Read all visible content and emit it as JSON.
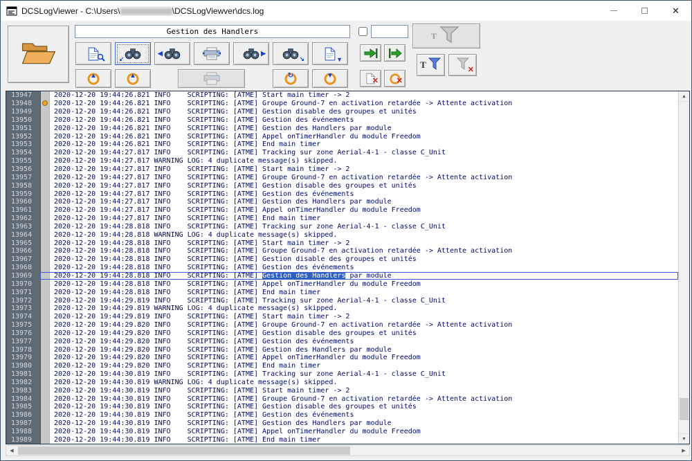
{
  "window": {
    "title_prefix": "DCSLogViewer - C:\\Users\\",
    "title_redacted": "██████████████",
    "title_suffix": "\\DCSLogViewver\\dcs.log"
  },
  "icons": {
    "close": "✕",
    "minimize": "–",
    "maximize": "▢",
    "arrow_up": "▲",
    "arrow_down": "▼",
    "arrow_left": "◀",
    "arrow_right": "▶",
    "arrow_down_left": "↙",
    "arrow_down_right": "↘",
    "refresh": "↻",
    "red_x": "✕",
    "letter_t": "T",
    "scroll_up": "▲",
    "scroll_down": "▼",
    "scroll_left": "◀",
    "scroll_right": "▶"
  },
  "search": {
    "value": "Gestion des Handlers"
  },
  "filter_input": {
    "value": ""
  },
  "log": {
    "selected_line": 13969,
    "marker_line": 13948,
    "highlight": "Gestion des Handlers",
    "entries": [
      {
        "n": 13947,
        "t": "2020-12-20 19:44:26.821 INFO    SCRIPTING: [ATME] Start main timer -> 2"
      },
      {
        "n": 13948,
        "t": "2020-12-20 19:44:26.821 INFO    SCRIPTING: [ATME] Groupe Ground-7 en activation retardée -> Attente activation"
      },
      {
        "n": 13949,
        "t": "2020-12-20 19:44:26.821 INFO    SCRIPTING: [ATME] Gestion disable des groupes et unités"
      },
      {
        "n": 13950,
        "t": "2020-12-20 19:44:26.821 INFO    SCRIPTING: [ATME] Gestion des événements"
      },
      {
        "n": 13951,
        "t": "2020-12-20 19:44:26.821 INFO    SCRIPTING: [ATME] Gestion des Handlers par module"
      },
      {
        "n": 13952,
        "t": "2020-12-20 19:44:26.821 INFO    SCRIPTING: [ATME] Appel onTimerHandler du module Freedom"
      },
      {
        "n": 13953,
        "t": "2020-12-20 19:44:26.821 INFO    SCRIPTING: [ATME] End main timer"
      },
      {
        "n": 13954,
        "t": "2020-12-20 19:44:27.817 INFO    SCRIPTING: [ATME] Tracking sur zone Aerial-4-1 - classe C_Unit"
      },
      {
        "n": 13955,
        "t": "2020-12-20 19:44:27.817 WARNING LOG: 4 duplicate message(s) skipped."
      },
      {
        "n": 13956,
        "t": "2020-12-20 19:44:27.817 INFO    SCRIPTING: [ATME] Start main timer -> 2"
      },
      {
        "n": 13957,
        "t": "2020-12-20 19:44:27.817 INFO    SCRIPTING: [ATME] Groupe Ground-7 en activation retardée -> Attente activation"
      },
      {
        "n": 13958,
        "t": "2020-12-20 19:44:27.817 INFO    SCRIPTING: [ATME] Gestion disable des groupes et unités"
      },
      {
        "n": 13959,
        "t": "2020-12-20 19:44:27.817 INFO    SCRIPTING: [ATME] Gestion des événements"
      },
      {
        "n": 13960,
        "t": "2020-12-20 19:44:27.817 INFO    SCRIPTING: [ATME] Gestion des Handlers par module"
      },
      {
        "n": 13961,
        "t": "2020-12-20 19:44:27.817 INFO    SCRIPTING: [ATME] Appel onTimerHandler du module Freedom"
      },
      {
        "n": 13962,
        "t": "2020-12-20 19:44:27.817 INFO    SCRIPTING: [ATME] End main timer"
      },
      {
        "n": 13963,
        "t": "2020-12-20 19:44:28.818 INFO    SCRIPTING: [ATME] Tracking sur zone Aerial-4-1 - classe C_Unit"
      },
      {
        "n": 13964,
        "t": "2020-12-20 19:44:28.818 WARNING LOG: 4 duplicate message(s) skipped."
      },
      {
        "n": 13965,
        "t": "2020-12-20 19:44:28.818 INFO    SCRIPTING: [ATME] Start main timer -> 2"
      },
      {
        "n": 13966,
        "t": "2020-12-20 19:44:28.818 INFO    SCRIPTING: [ATME] Groupe Ground-7 en activation retardée -> Attente activation"
      },
      {
        "n": 13967,
        "t": "2020-12-20 19:44:28.818 INFO    SCRIPTING: [ATME] Gestion disable des groupes et unités"
      },
      {
        "n": 13968,
        "t": "2020-12-20 19:44:28.818 INFO    SCRIPTING: [ATME] Gestion des événements"
      },
      {
        "n": 13969,
        "t": "2020-12-20 19:44:28.818 INFO    SCRIPTING: [ATME] Gestion des Handlers par module"
      },
      {
        "n": 13970,
        "t": "2020-12-20 19:44:28.818 INFO    SCRIPTING: [ATME] Appel onTimerHandler du module Freedom"
      },
      {
        "n": 13971,
        "t": "2020-12-20 19:44:28.818 INFO    SCRIPTING: [ATME] End main timer"
      },
      {
        "n": 13972,
        "t": "2020-12-20 19:44:29.819 INFO    SCRIPTING: [ATME] Tracking sur zone Aerial-4-1 - classe C_Unit"
      },
      {
        "n": 13973,
        "t": "2020-12-20 19:44:29.819 WARNING LOG: 4 duplicate message(s) skipped."
      },
      {
        "n": 13974,
        "t": "2020-12-20 19:44:29.819 INFO    SCRIPTING: [ATME] Start main timer -> 2"
      },
      {
        "n": 13975,
        "t": "2020-12-20 19:44:29.820 INFO    SCRIPTING: [ATME] Groupe Ground-7 en activation retardée -> Attente activation"
      },
      {
        "n": 13976,
        "t": "2020-12-20 19:44:29.820 INFO    SCRIPTING: [ATME] Gestion disable des groupes et unités"
      },
      {
        "n": 13977,
        "t": "2020-12-20 19:44:29.820 INFO    SCRIPTING: [ATME] Gestion des événements"
      },
      {
        "n": 13978,
        "t": "2020-12-20 19:44:29.820 INFO    SCRIPTING: [ATME] Gestion des Handlers par module"
      },
      {
        "n": 13979,
        "t": "2020-12-20 19:44:29.820 INFO    SCRIPTING: [ATME] Appel onTimerHandler du module Freedom"
      },
      {
        "n": 13980,
        "t": "2020-12-20 19:44:29.820 INFO    SCRIPTING: [ATME] End main timer"
      },
      {
        "n": 13981,
        "t": "2020-12-20 19:44:30.819 INFO    SCRIPTING: [ATME] Tracking sur zone Aerial-4-1 - classe C_Unit"
      },
      {
        "n": 13982,
        "t": "2020-12-20 19:44:30.819 WARNING LOG: 4 duplicate message(s) skipped."
      },
      {
        "n": 13983,
        "t": "2020-12-20 19:44:30.819 INFO    SCRIPTING: [ATME] Start main timer -> 2"
      },
      {
        "n": 13984,
        "t": "2020-12-20 19:44:30.819 INFO    SCRIPTING: [ATME] Groupe Ground-7 en activation retardée -> Attente activation"
      },
      {
        "n": 13985,
        "t": "2020-12-20 19:44:30.819 INFO    SCRIPTING: [ATME] Gestion disable des groupes et unités"
      },
      {
        "n": 13986,
        "t": "2020-12-20 19:44:30.819 INFO    SCRIPTING: [ATME] Gestion des événements"
      },
      {
        "n": 13987,
        "t": "2020-12-20 19:44:30.819 INFO    SCRIPTING: [ATME] Gestion des Handlers par module"
      },
      {
        "n": 13988,
        "t": "2020-12-20 19:44:30.819 INFO    SCRIPTING: [ATME] Appel onTimerHandler du module Freedom"
      },
      {
        "n": 13989,
        "t": "2020-12-20 19:44:30.819 INFO    SCRIPTING: [ATME] End main timer"
      }
    ]
  }
}
